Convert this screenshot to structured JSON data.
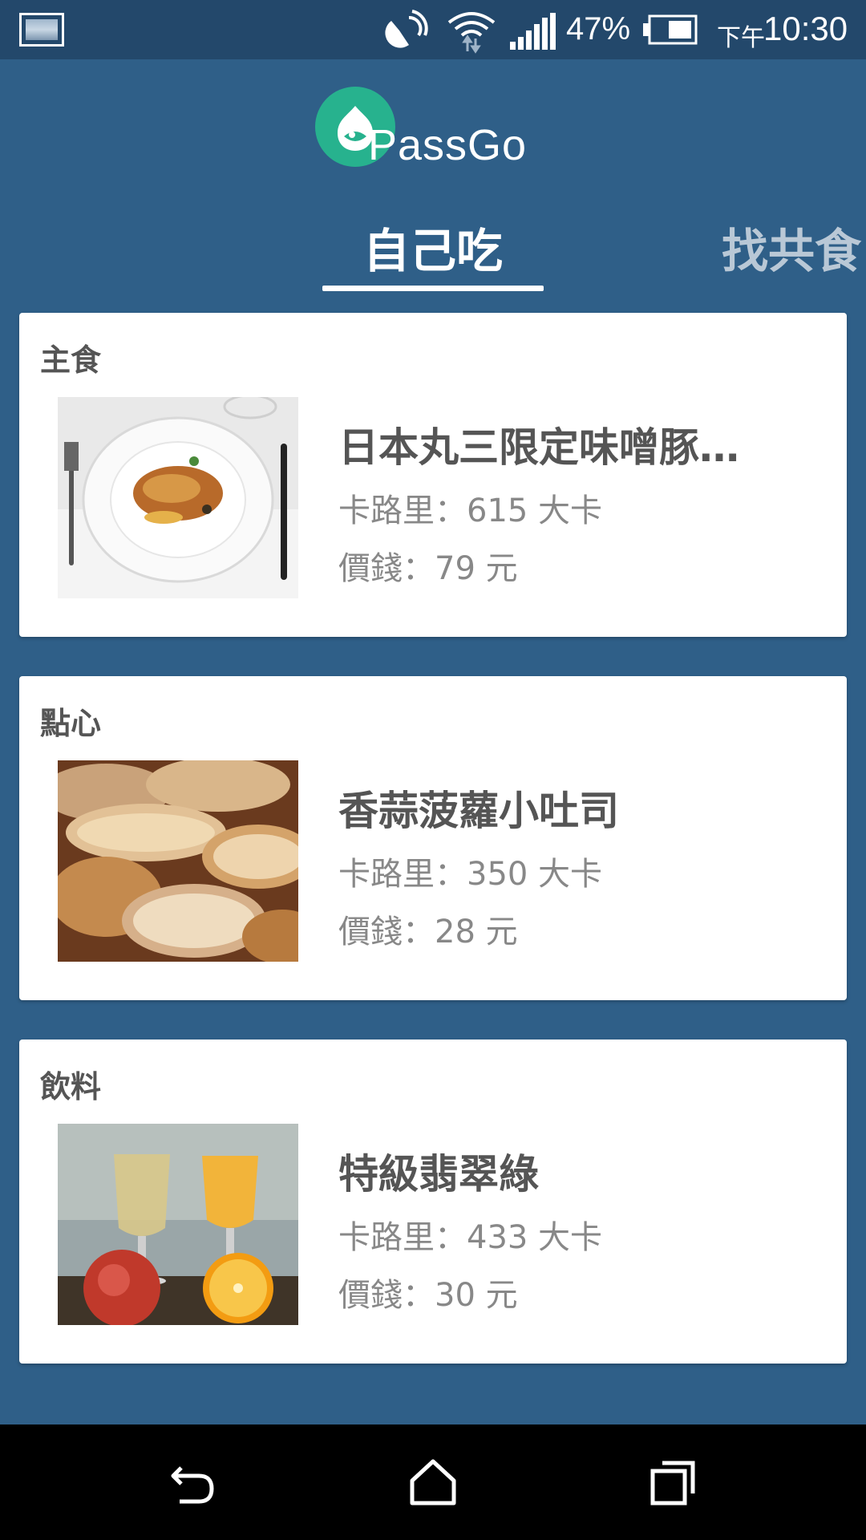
{
  "status_bar": {
    "battery_percent": "47%",
    "time_prefix": "下午",
    "time": "10:30",
    "icons": [
      "screenshot-thumbnail-icon",
      "nfc-icon",
      "wifi-icon",
      "signal-icon",
      "battery-icon"
    ]
  },
  "header": {
    "logo_text": "PassGo",
    "brand_color": "#27b28e"
  },
  "tabs": [
    {
      "label": "自己吃",
      "active": true
    },
    {
      "label": "找共食",
      "active": false
    }
  ],
  "cards": [
    {
      "category": "主食",
      "name": "日本丸三限定味噌豚…",
      "calories_line": "卡路里：615 大卡",
      "price_line": "價錢：79 元",
      "image": "plated-meat-dish"
    },
    {
      "category": "點心",
      "name": "香蒜菠蘿小吐司",
      "calories_line": "卡路里：350 大卡",
      "price_line": "價錢：28 元",
      "image": "sliced-bread"
    },
    {
      "category": "飲料",
      "name": "特級翡翠綠",
      "calories_line": "卡路里：433 大卡",
      "price_line": "價錢：30 元",
      "image": "juice-glasses-and-fruit"
    }
  ],
  "nav_bar": {
    "buttons": [
      "back-icon",
      "home-icon",
      "recents-icon"
    ]
  },
  "colors": {
    "background": "#2f5f88",
    "status_bar": "#23486b",
    "inactive_tab": "#b9c8d6"
  }
}
